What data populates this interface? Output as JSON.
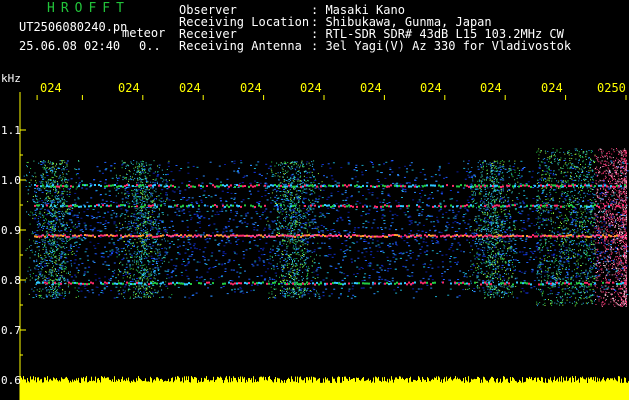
{
  "header": {
    "program_name": "HROFFT",
    "file_name": "UT2506080240.pn",
    "file_suffix": "meteor",
    "datetime": "25.06.08 02:40",
    "count_field": "0..",
    "info_rows": [
      {
        "label": "Observer",
        "value": ": Masaki Kano"
      },
      {
        "label": "Receiving Location",
        "value": ": Shibukawa, Gunma, Japan"
      },
      {
        "label": "Receiver",
        "value": ": RTL-SDR SDR# 43dB L15 103.2MHz CW"
      },
      {
        "label": "Receiving Antenna",
        "value": ": 3el Yagi(V) Az 330 for Vladivostok"
      }
    ]
  },
  "colors": {
    "text": "#ffffff",
    "title": "#22c43a",
    "axis": "#ffff00",
    "background": "#000000",
    "noise_floor_band": "#ffff00",
    "echo_strong": "#ff2a6a",
    "echo_mid": "#22cc44",
    "echo_weak": "#1f5fff"
  },
  "chart_data": {
    "type": "heatmap",
    "title": "",
    "xlabel": "",
    "ylabel": "kHz",
    "x_tick_labels": [
      "024",
      "024",
      "024",
      "024",
      "024",
      "024",
      "024",
      "024",
      "024",
      "0250"
    ],
    "y_tick_labels": [
      "1.1",
      "1.0",
      "0.9",
      "0.8",
      "0.7",
      "0.6"
    ],
    "y_ticks": [
      1.1,
      1.0,
      0.9,
      0.8,
      0.7,
      0.6
    ],
    "ylim": [
      0.6,
      1.15
    ],
    "signal_band_khz": [
      0.78,
      1.02
    ],
    "persistent_lines_khz": [
      {
        "freq": 0.99,
        "intensity": 0.8
      },
      {
        "freq": 0.95,
        "intensity": 0.5
      },
      {
        "freq": 0.89,
        "intensity": 1.0
      },
      {
        "freq": 0.795,
        "intensity": 0.7
      }
    ],
    "minute_marks": [
      0.25,
      1.0,
      2.0,
      3.0,
      4.0,
      5.0,
      6.0,
      7.0,
      8.0,
      9.0,
      10.0
    ],
    "bright_events_minute": [
      0.5,
      2.0,
      4.5,
      7.8
    ],
    "storm_end_minute": 10.0,
    "x_minutes_span": [
      0,
      10
    ],
    "bottom_band": "noise floor"
  }
}
